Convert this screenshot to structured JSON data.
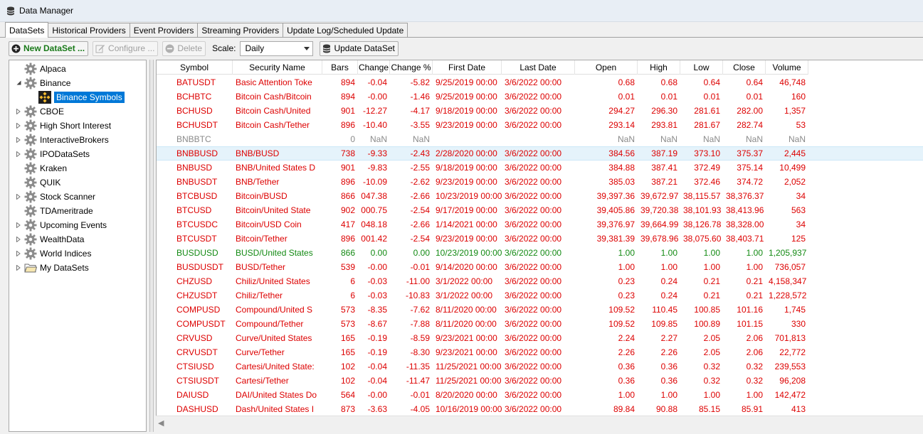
{
  "window": {
    "title": "Data Manager",
    "icon": "database-icon"
  },
  "tabs": [
    {
      "label": "DataSets",
      "active": true
    },
    {
      "label": "Historical Providers"
    },
    {
      "label": "Event Providers"
    },
    {
      "label": "Streaming Providers"
    },
    {
      "label": "Update Log/Scheduled Update"
    }
  ],
  "toolbar": {
    "new_label": "New DataSet ...",
    "configure_label": "Configure ...",
    "delete_label": "Delete",
    "scale_label": "Scale:",
    "scale_value": "Daily",
    "update_label": "Update DataSet"
  },
  "tree": [
    {
      "label": "Alpaca",
      "icon": "gear-icon",
      "expander": "none",
      "indent": 0
    },
    {
      "label": "Binance",
      "icon": "gear-icon",
      "expander": "expanded",
      "indent": 0
    },
    {
      "label": "Binance Symbols",
      "icon": "binance-icon",
      "expander": "none",
      "indent": 1,
      "selected": true
    },
    {
      "label": "CBOE",
      "icon": "gear-icon",
      "expander": "collapsed",
      "indent": 0
    },
    {
      "label": "High Short Interest",
      "icon": "gear-icon",
      "expander": "collapsed",
      "indent": 0
    },
    {
      "label": "InteractiveBrokers",
      "icon": "gear-icon",
      "expander": "collapsed",
      "indent": 0
    },
    {
      "label": "IPODataSets",
      "icon": "gear-icon",
      "expander": "collapsed",
      "indent": 0
    },
    {
      "label": "Kraken",
      "icon": "gear-icon",
      "expander": "none",
      "indent": 0
    },
    {
      "label": "QUIK",
      "icon": "gear-icon",
      "expander": "none",
      "indent": 0
    },
    {
      "label": "Stock Scanner",
      "icon": "gear-icon",
      "expander": "collapsed",
      "indent": 0
    },
    {
      "label": "TDAmeritrade",
      "icon": "gear-icon",
      "expander": "none",
      "indent": 0
    },
    {
      "label": "Upcoming Events",
      "icon": "gear-icon",
      "expander": "collapsed",
      "indent": 0
    },
    {
      "label": "WealthData",
      "icon": "gear-icon",
      "expander": "collapsed",
      "indent": 0
    },
    {
      "label": "World Indices",
      "icon": "gear-icon",
      "expander": "collapsed",
      "indent": 0
    },
    {
      "label": "My DataSets",
      "icon": "folder-icon",
      "expander": "collapsed",
      "indent": 0
    }
  ],
  "grid": {
    "columns": [
      "Symbol",
      "Security Name",
      "Bars",
      "Change",
      "Change %",
      "First Date",
      "Last Date",
      "Open",
      "High",
      "Low",
      "Close",
      "Volume"
    ],
    "rows": [
      {
        "cells": [
          "BATUSDT",
          "Basic Attention Toke",
          "894",
          "-0.04",
          "-5.82",
          "9/25/2019 00:00",
          "3/6/2022 00:00",
          "0.68",
          "0.68",
          "0.64",
          "0.64",
          "46,748"
        ],
        "color": "red"
      },
      {
        "cells": [
          "BCHBTC",
          "Bitcoin Cash/Bitcoin",
          "894",
          "-0.00",
          "-1.46",
          "9/25/2019 00:00",
          "3/6/2022 00:00",
          "0.01",
          "0.01",
          "0.01",
          "0.01",
          "160"
        ],
        "color": "red"
      },
      {
        "cells": [
          "BCHUSD",
          "Bitcoin Cash/United",
          "901",
          "-12.27",
          "-4.17",
          "9/18/2019 00:00",
          "3/6/2022 00:00",
          "294.27",
          "296.30",
          "281.61",
          "282.00",
          "1,357"
        ],
        "color": "red"
      },
      {
        "cells": [
          "BCHUSDT",
          "Bitcoin Cash/Tether",
          "896",
          "-10.40",
          "-3.55",
          "9/23/2019 00:00",
          "3/6/2022 00:00",
          "293.14",
          "293.81",
          "281.67",
          "282.74",
          "53"
        ],
        "color": "red"
      },
      {
        "cells": [
          "BNBBTC",
          "",
          "0",
          "NaN",
          "NaN",
          "",
          "",
          "NaN",
          "NaN",
          "NaN",
          "NaN",
          "NaN"
        ],
        "color": "gray"
      },
      {
        "cells": [
          "BNBBUSD",
          "BNB/BUSD",
          "738",
          "-9.33",
          "-2.43",
          "2/28/2020 00:00",
          "3/6/2022 00:00",
          "384.56",
          "387.19",
          "373.10",
          "375.37",
          "2,445"
        ],
        "color": "red",
        "selected": true
      },
      {
        "cells": [
          "BNBUSD",
          "BNB/United States D",
          "901",
          "-9.83",
          "-2.55",
          "9/18/2019 00:00",
          "3/6/2022 00:00",
          "384.88",
          "387.41",
          "372.49",
          "375.14",
          "10,499"
        ],
        "color": "red"
      },
      {
        "cells": [
          "BNBUSDT",
          "BNB/Tether",
          "896",
          "-10.09",
          "-2.62",
          "9/23/2019 00:00",
          "3/6/2022 00:00",
          "385.03",
          "387.21",
          "372.46",
          "374.72",
          "2,052"
        ],
        "color": "red"
      },
      {
        "cells": [
          "BTCBUSD",
          "Bitcoin/BUSD",
          "866",
          "047.38",
          "-2.66",
          "10/23/2019 00:00",
          "3/6/2022 00:00",
          "39,397.36",
          "39,672.97",
          "38,115.57",
          "38,376.37",
          "34"
        ],
        "color": "red"
      },
      {
        "cells": [
          "BTCUSD",
          "Bitcoin/United State",
          "902",
          "000.75",
          "-2.54",
          "9/17/2019 00:00",
          "3/6/2022 00:00",
          "39,405.86",
          "39,720.38",
          "38,101.93",
          "38,413.96",
          "563"
        ],
        "color": "red"
      },
      {
        "cells": [
          "BTCUSDC",
          "Bitcoin/USD Coin",
          "417",
          "048.18",
          "-2.66",
          "1/14/2021 00:00",
          "3/6/2022 00:00",
          "39,376.97",
          "39,664.99",
          "38,126.78",
          "38,328.00",
          "34"
        ],
        "color": "red"
      },
      {
        "cells": [
          "BTCUSDT",
          "Bitcoin/Tether",
          "896",
          "001.42",
          "-2.54",
          "9/23/2019 00:00",
          "3/6/2022 00:00",
          "39,381.39",
          "39,678.96",
          "38,075.60",
          "38,403.71",
          "125"
        ],
        "color": "red"
      },
      {
        "cells": [
          "BUSDUSD",
          "BUSD/United States",
          "866",
          "0.00",
          "0.00",
          "10/23/2019 00:00",
          "3/6/2022 00:00",
          "1.00",
          "1.00",
          "1.00",
          "1.00",
          "1,205,937"
        ],
        "color": "green"
      },
      {
        "cells": [
          "BUSDUSDT",
          "BUSD/Tether",
          "539",
          "-0.00",
          "-0.01",
          "9/14/2020 00:00",
          "3/6/2022 00:00",
          "1.00",
          "1.00",
          "1.00",
          "1.00",
          "736,057"
        ],
        "color": "red"
      },
      {
        "cells": [
          "CHZUSD",
          "Chiliz/United States",
          "6",
          "-0.03",
          "-11.00",
          "3/1/2022 00:00",
          "3/6/2022 00:00",
          "0.23",
          "0.24",
          "0.21",
          "0.21",
          "4,158,347"
        ],
        "color": "red"
      },
      {
        "cells": [
          "CHZUSDT",
          "Chiliz/Tether",
          "6",
          "-0.03",
          "-10.83",
          "3/1/2022 00:00",
          "3/6/2022 00:00",
          "0.23",
          "0.24",
          "0.21",
          "0.21",
          "1,228,572"
        ],
        "color": "red"
      },
      {
        "cells": [
          "COMPUSD",
          "Compound/United S",
          "573",
          "-8.35",
          "-7.62",
          "8/11/2020 00:00",
          "3/6/2022 00:00",
          "109.52",
          "110.45",
          "100.85",
          "101.16",
          "1,745"
        ],
        "color": "red"
      },
      {
        "cells": [
          "COMPUSDT",
          "Compound/Tether",
          "573",
          "-8.67",
          "-7.88",
          "8/11/2020 00:00",
          "3/6/2022 00:00",
          "109.52",
          "109.85",
          "100.89",
          "101.15",
          "330"
        ],
        "color": "red"
      },
      {
        "cells": [
          "CRVUSD",
          "Curve/United States",
          "165",
          "-0.19",
          "-8.59",
          "9/23/2021 00:00",
          "3/6/2022 00:00",
          "2.24",
          "2.27",
          "2.05",
          "2.06",
          "701,813"
        ],
        "color": "red"
      },
      {
        "cells": [
          "CRVUSDT",
          "Curve/Tether",
          "165",
          "-0.19",
          "-8.30",
          "9/23/2021 00:00",
          "3/6/2022 00:00",
          "2.26",
          "2.26",
          "2.05",
          "2.06",
          "22,772"
        ],
        "color": "red"
      },
      {
        "cells": [
          "CTSIUSD",
          "Cartesi/United State:",
          "102",
          "-0.04",
          "-11.35",
          "11/25/2021 00:00",
          "3/6/2022 00:00",
          "0.36",
          "0.36",
          "0.32",
          "0.32",
          "239,553"
        ],
        "color": "red"
      },
      {
        "cells": [
          "CTSIUSDT",
          "Cartesi/Tether",
          "102",
          "-0.04",
          "-11.47",
          "11/25/2021 00:00",
          "3/6/2022 00:00",
          "0.36",
          "0.36",
          "0.32",
          "0.32",
          "96,208"
        ],
        "color": "red"
      },
      {
        "cells": [
          "DAIUSD",
          "DAI/United States Do",
          "564",
          "-0.00",
          "-0.01",
          "8/20/2020 00:00",
          "3/6/2022 00:00",
          "1.00",
          "1.00",
          "1.00",
          "1.00",
          "142,472"
        ],
        "color": "red"
      },
      {
        "cells": [
          "DASHUSD",
          "Dash/United States I",
          "873",
          "-3.63",
          "-4.05",
          "10/16/2019 00:00",
          "3/6/2022 00:00",
          "89.84",
          "90.88",
          "85.15",
          "85.91",
          "413"
        ],
        "color": "red"
      }
    ]
  },
  "colors": {
    "negative": "#dd0000",
    "neutral": "#138a13",
    "empty": "#8a8a8a",
    "selection": "#0078d7"
  }
}
